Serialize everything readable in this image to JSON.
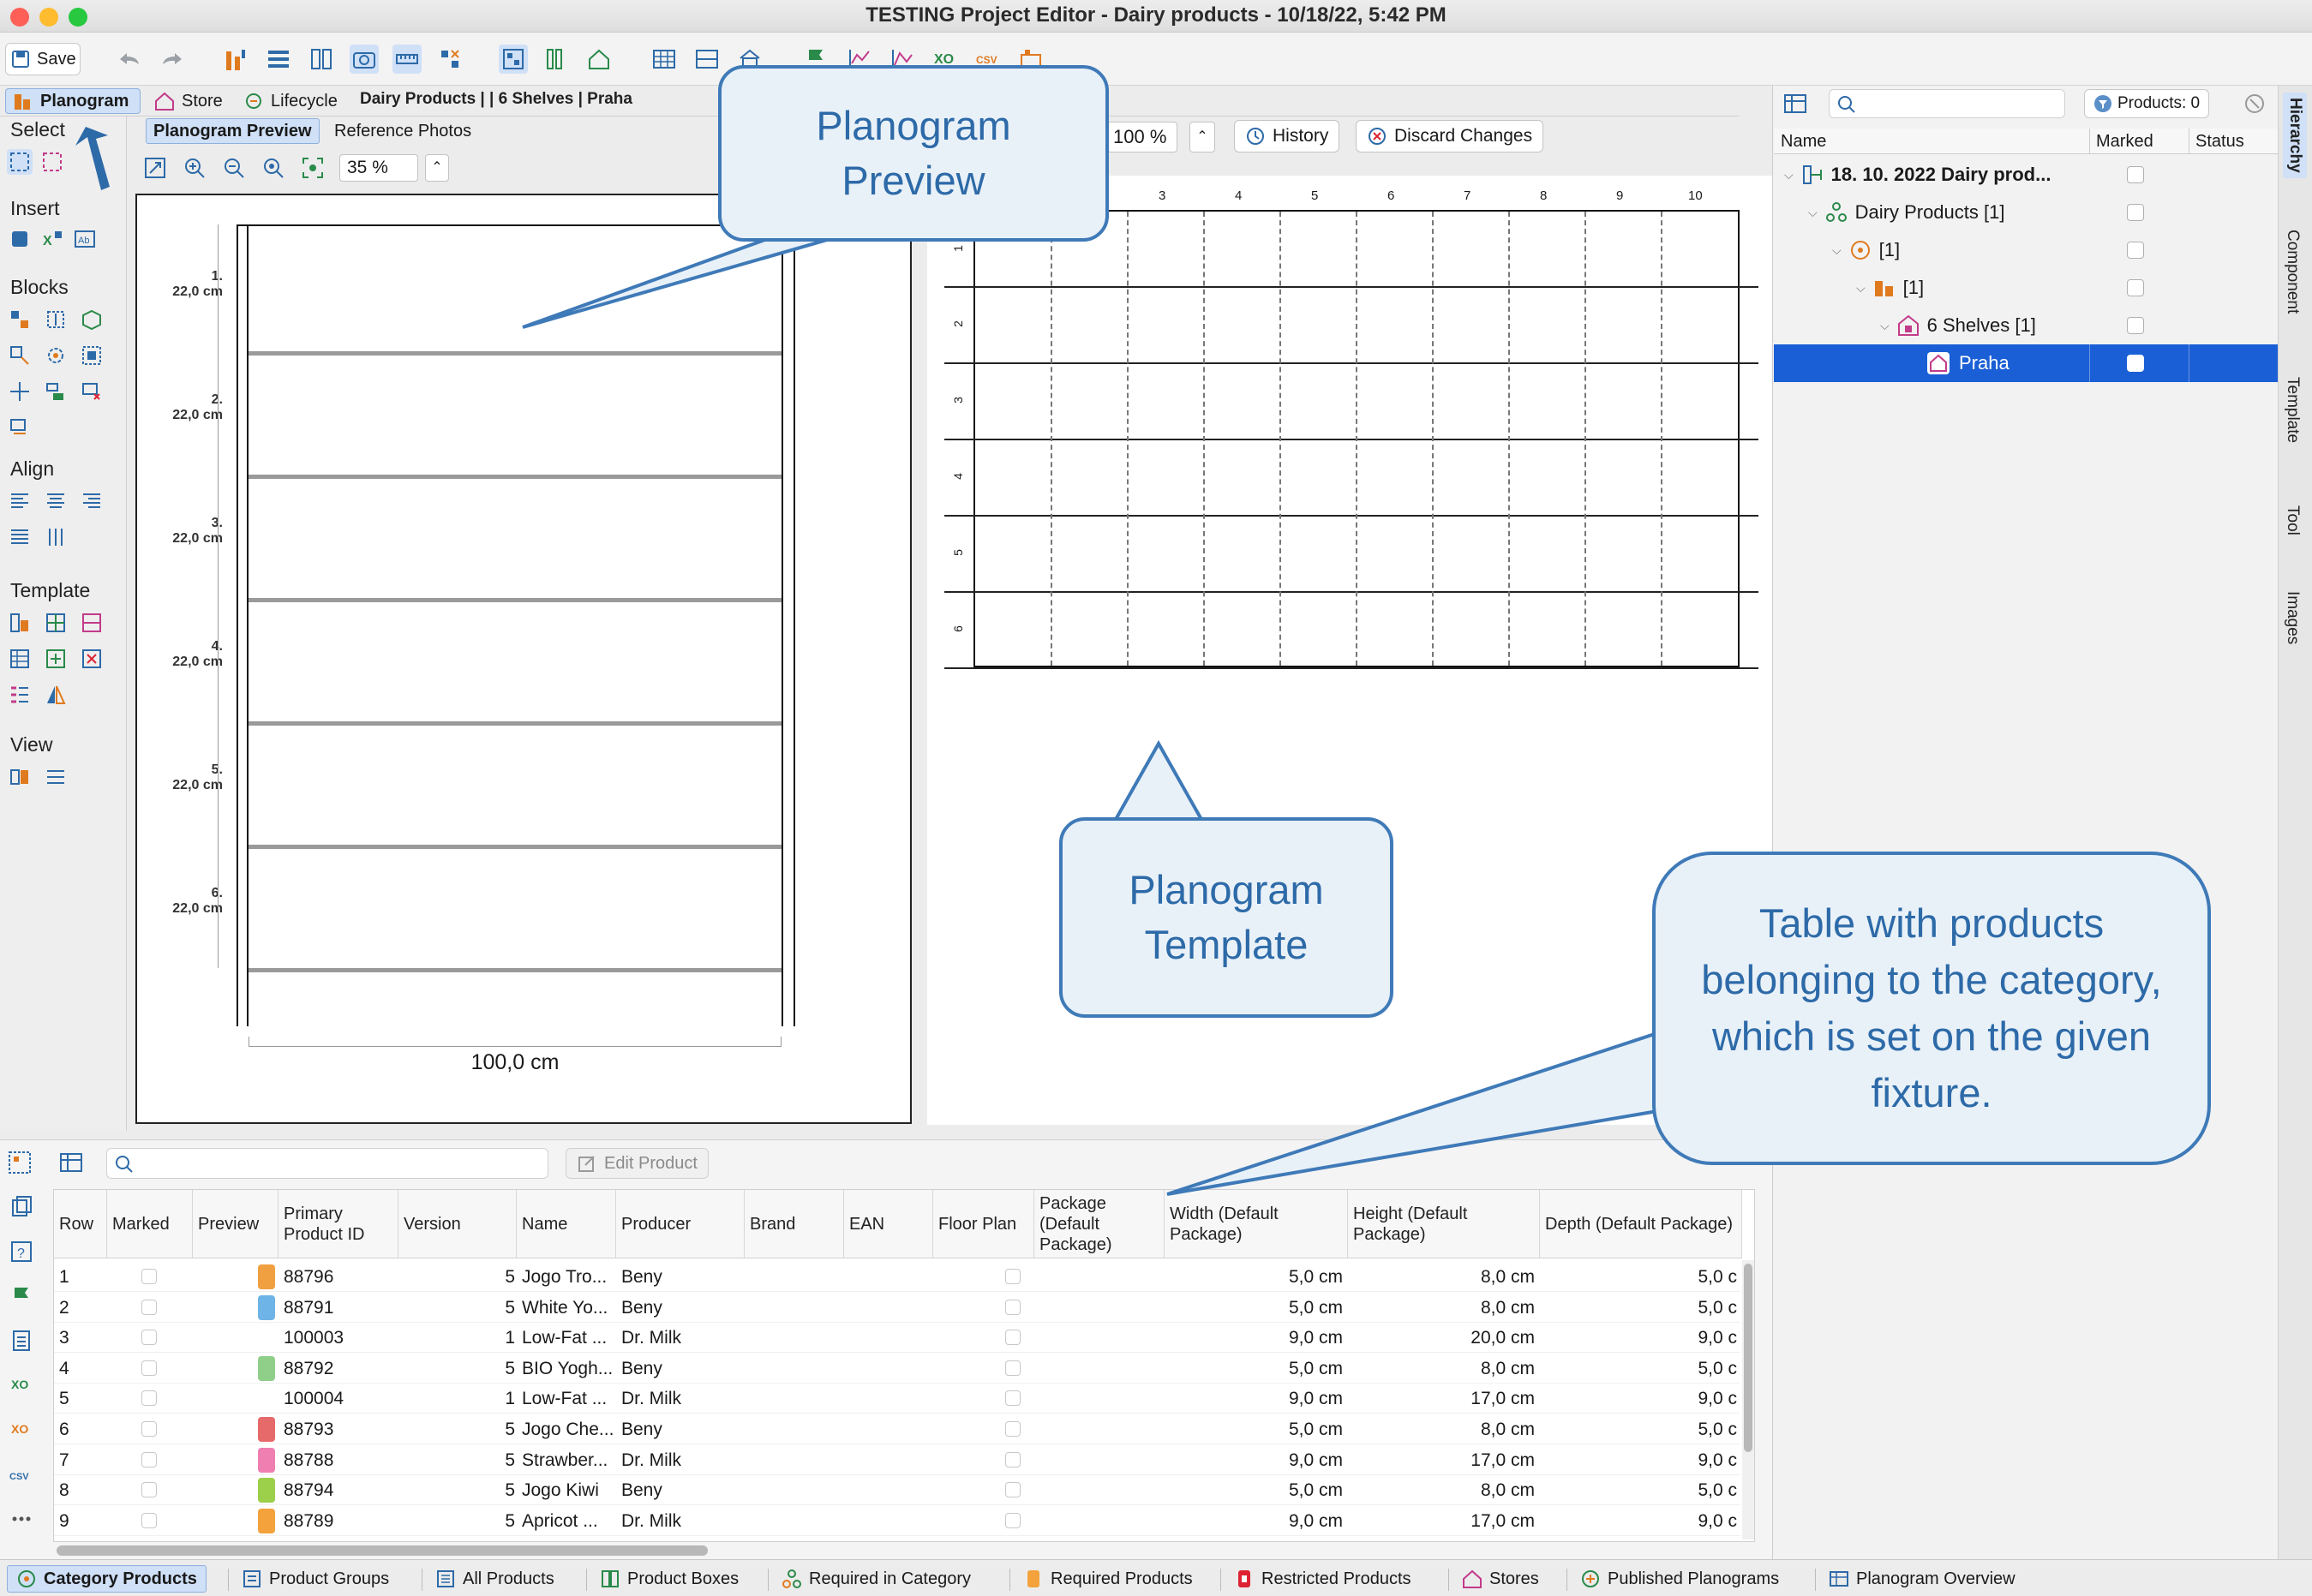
{
  "window": {
    "title": "TESTING Project Editor - Dairy products - 10/18/22, 5:42 PM"
  },
  "toolbar": {
    "save_label": "Save"
  },
  "main_tabs": [
    {
      "label": "Planogram",
      "icon": "planogram-icon",
      "active": true
    },
    {
      "label": "Store",
      "icon": "store-icon"
    },
    {
      "label": "Lifecycle",
      "icon": "lifecycle-icon"
    }
  ],
  "breadcrumb": {
    "text": "Dairy Products | | 6 Shelves | Praha"
  },
  "left_panel": {
    "sections": [
      "Select",
      "Insert",
      "Blocks",
      "Align",
      "Template",
      "View"
    ]
  },
  "preview": {
    "tabs": [
      "Planogram Preview",
      "Reference Photos"
    ],
    "zoom": "35 %",
    "shelves": [
      {
        "num": "1.",
        "height": "22,0 cm"
      },
      {
        "num": "2.",
        "height": "22,0 cm"
      },
      {
        "num": "3.",
        "height": "22,0 cm"
      },
      {
        "num": "4.",
        "height": "22,0 cm"
      },
      {
        "num": "5.",
        "height": "22,0 cm"
      },
      {
        "num": "6.",
        "height": "22,0 cm"
      }
    ],
    "width_label": "100,0 cm"
  },
  "template_pane": {
    "zoom": "100 %",
    "history_label": "History",
    "discard_label": "Discard Changes",
    "col_numbers": [
      "3",
      "4",
      "5",
      "6",
      "7",
      "8",
      "9",
      "10"
    ],
    "row_numbers": [
      "1",
      "2",
      "3",
      "4",
      "5",
      "6"
    ]
  },
  "callouts": {
    "preview": "Planogram Preview",
    "template": "Planogram Template",
    "table": "Table with products belonging to the category, which is set on the given fixture."
  },
  "hierarchy": {
    "products_filter": "Products: 0",
    "columns": [
      "Name",
      "Marked",
      "Status"
    ],
    "rows": [
      {
        "label": "18. 10. 2022 Dairy prod...",
        "bold": true,
        "indent": 0,
        "icon": "project-icon"
      },
      {
        "label": "Dairy Products [1]",
        "indent": 1,
        "icon": "category-icon"
      },
      {
        "label": "[1]",
        "indent": 2,
        "icon": "cluster-icon"
      },
      {
        "label": "[1]",
        "indent": 3,
        "icon": "fixture-icon"
      },
      {
        "label": "6 Shelves [1]",
        "indent": 4,
        "icon": "shelves-icon"
      },
      {
        "label": "Praha",
        "indent": 5,
        "icon": "store-icon",
        "selected": true
      }
    ]
  },
  "side_tabs": [
    "Hierarchy",
    "Component",
    "Template",
    "Tool",
    "Images"
  ],
  "products_table": {
    "edit_label": "Edit Product",
    "columns": [
      "Row",
      "Marked",
      "Preview",
      "Primary Product ID",
      "Version",
      "Name",
      "Producer",
      "Brand",
      "EAN",
      "Floor Plan",
      "Package (Default Package)",
      "Width (Default Package)",
      "Height (Default Package)",
      "Depth (Default Package)"
    ],
    "rows": [
      {
        "row": "1",
        "id": "88796",
        "version": "5",
        "name": "Jogo Tro...",
        "producer": "Beny",
        "width": "5,0 cm",
        "height": "8,0 cm",
        "depth": "5,0 c",
        "thumb": "#f0a040"
      },
      {
        "row": "2",
        "id": "88791",
        "version": "5",
        "name": "White Yo...",
        "producer": "Beny",
        "width": "5,0 cm",
        "height": "8,0 cm",
        "depth": "5,0 c",
        "thumb": "#6fb4e6"
      },
      {
        "row": "3",
        "id": "100003",
        "version": "1",
        "name": "Low-Fat ...",
        "producer": "Dr. Milk",
        "width": "9,0 cm",
        "height": "20,0 cm",
        "depth": "9,0 c",
        "thumb": ""
      },
      {
        "row": "4",
        "id": "88792",
        "version": "5",
        "name": "BIO Yogh...",
        "producer": "Beny",
        "width": "5,0 cm",
        "height": "8,0 cm",
        "depth": "5,0 c",
        "thumb": "#8fcf8a"
      },
      {
        "row": "5",
        "id": "100004",
        "version": "1",
        "name": "Low-Fat ...",
        "producer": "Dr. Milk",
        "width": "9,0 cm",
        "height": "17,0 cm",
        "depth": "9,0 c",
        "thumb": ""
      },
      {
        "row": "6",
        "id": "88793",
        "version": "5",
        "name": "Jogo Che...",
        "producer": "Beny",
        "width": "5,0 cm",
        "height": "8,0 cm",
        "depth": "5,0 c",
        "thumb": "#e66a6a"
      },
      {
        "row": "7",
        "id": "88788",
        "version": "5",
        "name": "Strawber...",
        "producer": "Dr. Milk",
        "width": "9,0 cm",
        "height": "17,0 cm",
        "depth": "9,0 c",
        "thumb": "#ef7fb0"
      },
      {
        "row": "8",
        "id": "88794",
        "version": "5",
        "name": "Jogo Kiwi",
        "producer": "Beny",
        "width": "5,0 cm",
        "height": "8,0 cm",
        "depth": "5,0 c",
        "thumb": "#9ccf4a"
      },
      {
        "row": "9",
        "id": "88789",
        "version": "5",
        "name": "Apricot ...",
        "producer": "Dr. Milk",
        "width": "9,0 cm",
        "height": "17,0 cm",
        "depth": "9,0 c",
        "thumb": "#f3a23c"
      }
    ]
  },
  "bottom_tabs": [
    {
      "label": "Category Products",
      "active": true
    },
    {
      "label": "Product Groups"
    },
    {
      "label": "All Products"
    },
    {
      "label": "Product Boxes"
    },
    {
      "label": "Required in Category"
    },
    {
      "label": "Required Products"
    },
    {
      "label": "Restricted Products"
    },
    {
      "label": "Stores"
    },
    {
      "label": "Published Planograms"
    },
    {
      "label": "Planogram Overview"
    }
  ]
}
